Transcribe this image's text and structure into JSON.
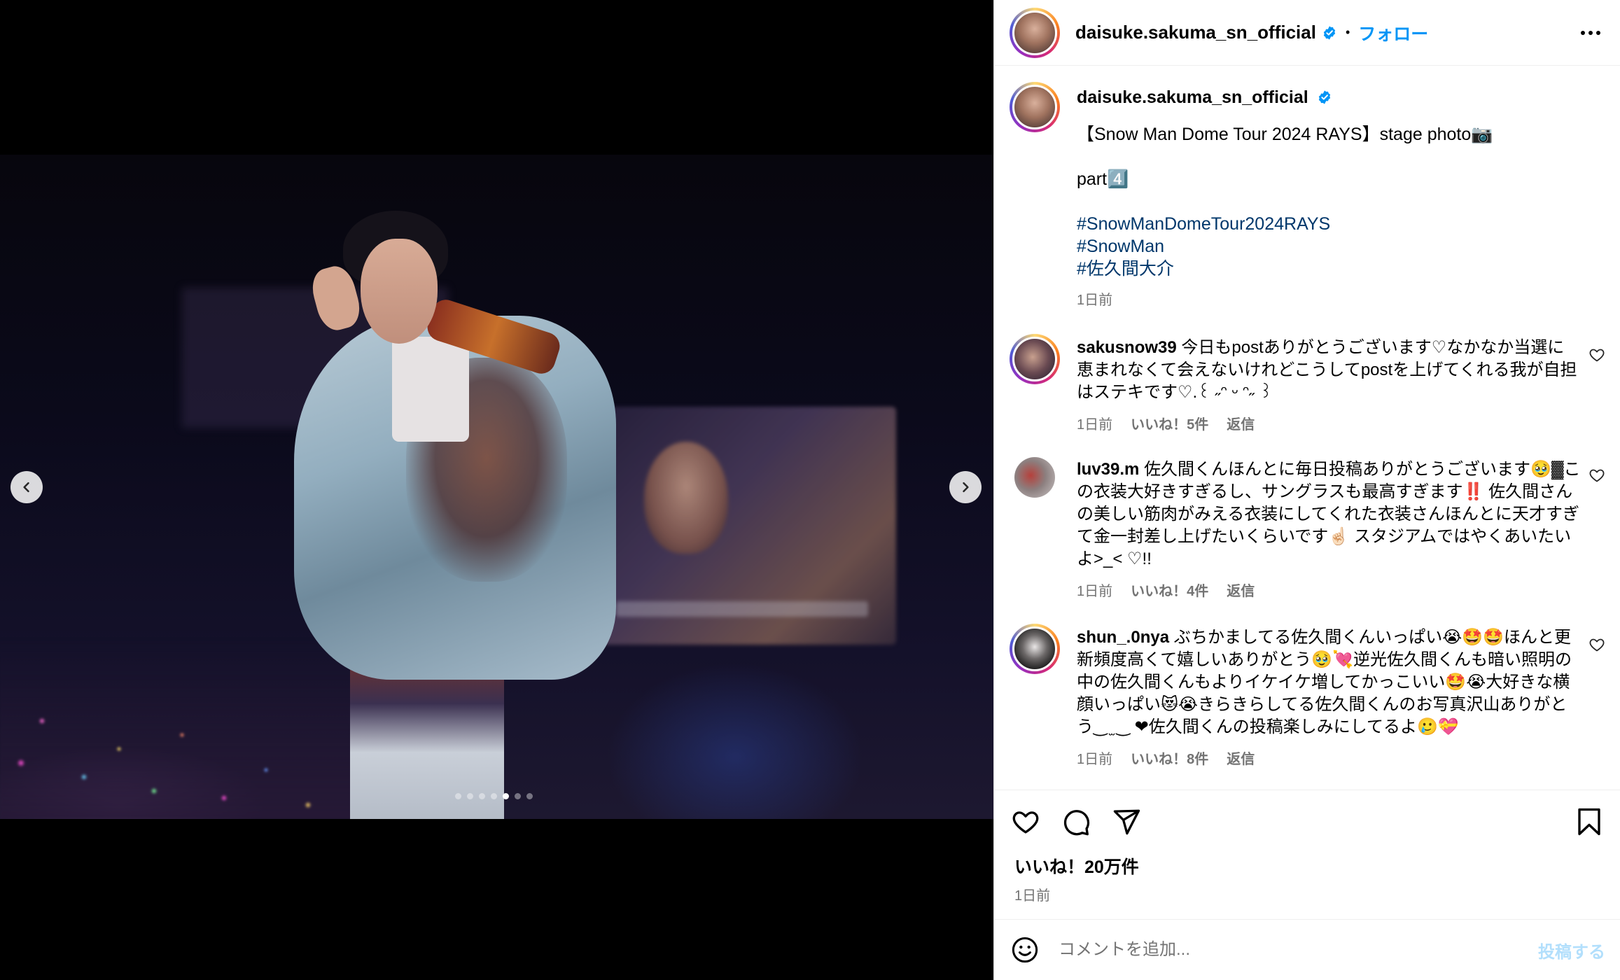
{
  "post": {
    "username": "daisuke.sakuma_sn_official",
    "separator": "•",
    "follow_label": "フォロー"
  },
  "caption": {
    "username": "daisuke.sakuma_sn_official",
    "line1": "【Snow Man Dome Tour 2024 RAYS】stage photo📷",
    "line2": "part4️⃣",
    "hashtags": [
      "#SnowManDomeTour2024RAYS",
      "#SnowMan",
      "#佐久間大介"
    ],
    "time": "1日前"
  },
  "comments": [
    {
      "username": "sakusnow39",
      "text": "今日もpostありがとうございます♡なかなか当選に恵まれなくて会えないけれどこうしてpostを上げてくれる我が自担はステキです♡.꒰ ˶ᵔ ᵕ ᵔ˶ ꒱",
      "time": "1日前",
      "likes": "いいね！5件",
      "reply": "返信"
    },
    {
      "username": "luv39.m",
      "text": "佐久間くんほんとに毎日投稿ありがとうございます🥹▓この衣装大好きすぎるし、サングラスも最高すぎます‼️ 佐久間さんの美しい筋肉がみえる衣装にしてくれた衣装さんほんとに天才すぎて金一封差し上げたいくらいです☝🏻 スタジアムではやくあいたいよ>_< ♡!!",
      "time": "1日前",
      "likes": "いいね！4件",
      "reply": "返信"
    },
    {
      "username": "shun_.0nya",
      "text": "ぶちかましてる佐久間くんいっぱい😭🤩🤩ほんと更新頻度高くて嬉しいありがとう🥹💘逆光佐久間くんも暗い照明の中の佐久間くんもよりイケイケ増してかっこいい🤩😭大好きな横顔いっぱい😻😭きらきらしてる佐久間くんのお写真沢山ありがとう‿ ̫ ‿ ❤︎佐久間くんの投稿楽しみにしてるよ🥲💝",
      "time": "1日前",
      "likes": "いいね！8件",
      "reply": "返信"
    }
  ],
  "engagement": {
    "likes": "いいね！20万件",
    "time": "1日前"
  },
  "add_comment": {
    "placeholder": "コメントを追加...",
    "post_label": "投稿する"
  },
  "carousel": {
    "slide_count": 7,
    "active_index": 4
  },
  "colors": {
    "accent": "#0095f6",
    "hashtag": "#00376b",
    "muted": "#737373",
    "post_disabled": "#b2dffc"
  },
  "icons": {
    "prev": "chevron-left-icon",
    "next": "chevron-right-icon",
    "more": "more-horizontal-icon",
    "verified": "verified-badge-icon",
    "like": "heart-icon",
    "comment": "comment-icon",
    "share": "share-icon",
    "save": "bookmark-icon",
    "emoji": "emoji-icon"
  }
}
